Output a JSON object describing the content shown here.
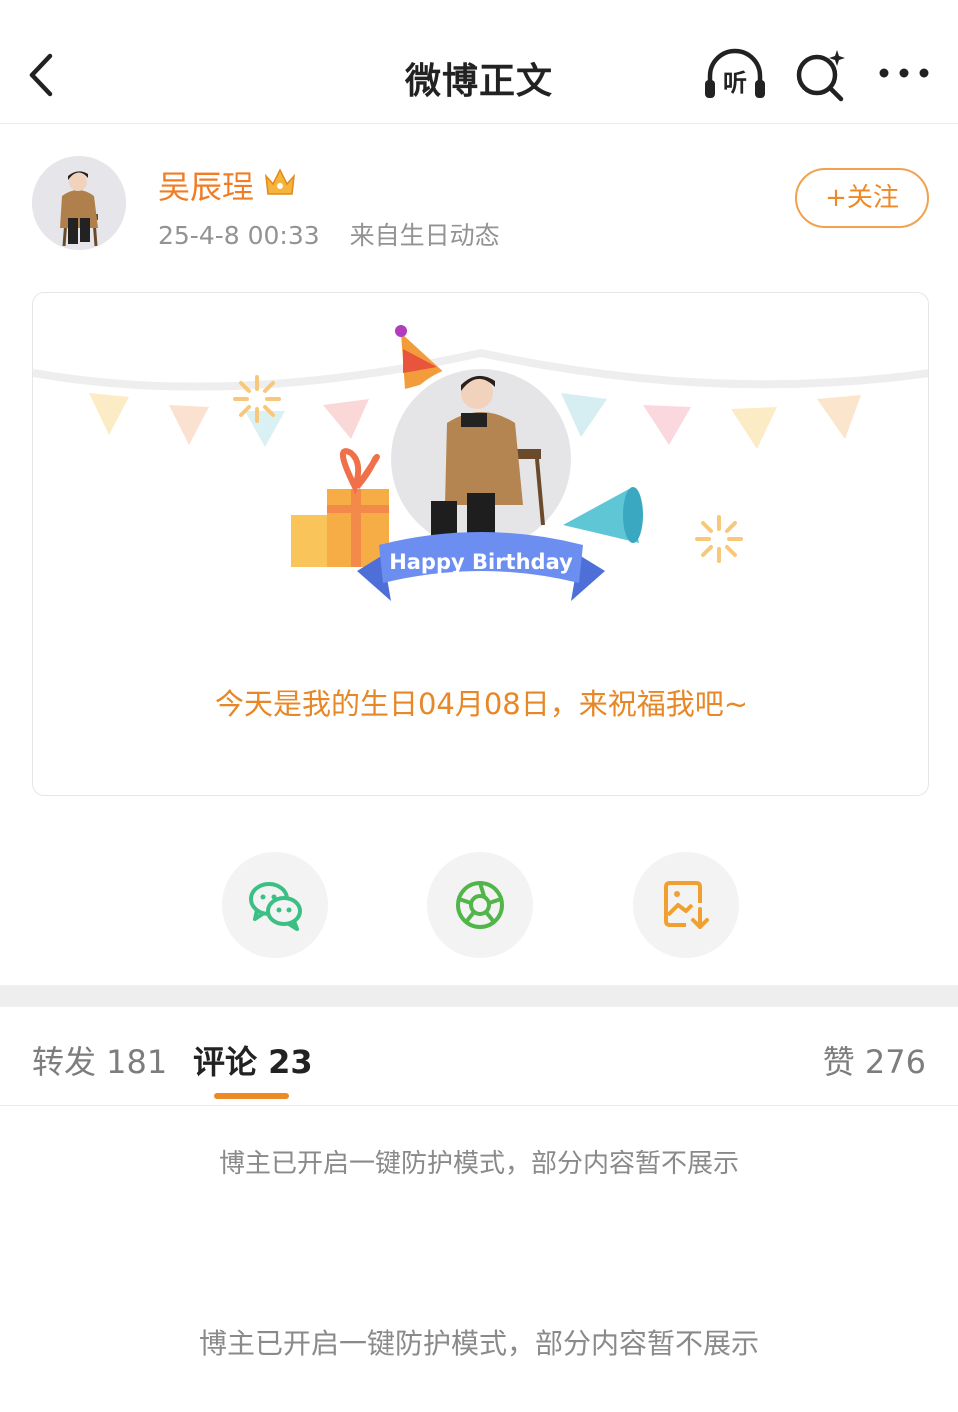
{
  "header": {
    "title": "微博正文",
    "back_icon": "chevron-left-icon",
    "listen_label": "听",
    "search_icon": "search-sparkle-icon",
    "more_icon": "more-dots-icon"
  },
  "post": {
    "author": "吴辰珵",
    "author_badge_icon": "crown-icon",
    "timestamp": "25-4-8 00:33",
    "source": "来自生日动态",
    "follow_label": "+关注"
  },
  "card": {
    "banner_text": "Happy Birthday",
    "message": "今天是我的生日04月08日，来祝福我吧~"
  },
  "share": [
    {
      "icon": "wechat-icon"
    },
    {
      "icon": "moments-icon"
    },
    {
      "icon": "save-image-icon"
    }
  ],
  "tabs": {
    "repost": "转发 181",
    "comments": "评论 23",
    "likes": "赞 276"
  },
  "notices": [
    "博主已开启一键防护模式，部分内容暂不展示",
    "博主已开启一键防护模式，部分内容暂不展示"
  ],
  "colors": {
    "accent": "#ee8a25",
    "author_name": "#f07d26",
    "wechat": "#3cbf84",
    "moments": "#52b54a"
  }
}
